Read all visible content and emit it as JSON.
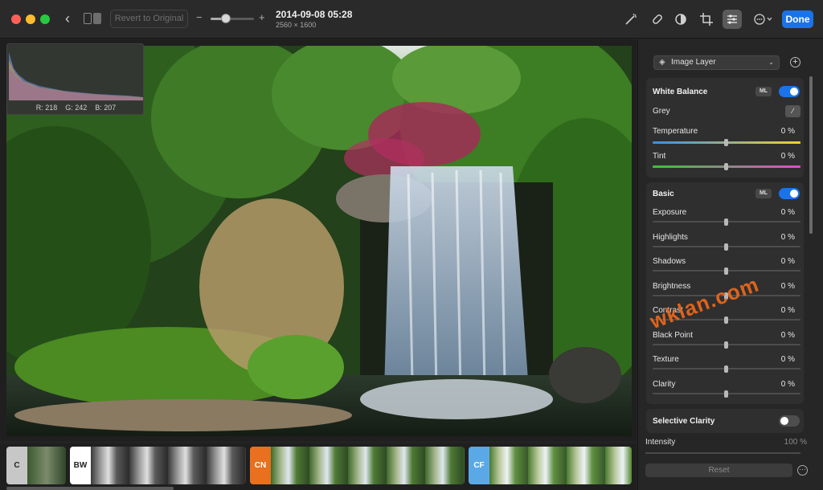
{
  "toolbar": {
    "revert_label": "Revert to Original",
    "zoom_minus": "−",
    "zoom_plus": "+",
    "zoom_level": 0.35,
    "title": "2014-09-08 05:28",
    "dimensions": "2560 × 1600",
    "done_label": "Done",
    "icons": [
      "auto-enhance-icon",
      "retouch-icon",
      "color-icon",
      "crop-icon",
      "adjust-icon",
      "more-icon"
    ]
  },
  "histogram": {
    "r": "R: 218",
    "g": "G: 242",
    "b": "B: 207"
  },
  "filmstrip": [
    {
      "label": "C",
      "color": "#c7c7c7"
    },
    {
      "label": "BW",
      "color": "#ffffff"
    },
    {
      "label": "CN",
      "color": "#e8701e"
    },
    {
      "label": "CF",
      "color": "#5aa9e6"
    }
  ],
  "panel": {
    "layer": "Image Layer",
    "white_balance": {
      "title": "White Balance",
      "ml": "ML",
      "grey": "Grey",
      "rows": [
        {
          "label": "Temperature",
          "value": "0 %"
        },
        {
          "label": "Tint",
          "value": "0 %"
        }
      ]
    },
    "basic": {
      "title": "Basic",
      "ml": "ML",
      "rows": [
        {
          "label": "Exposure",
          "value": "0 %"
        },
        {
          "label": "Highlights",
          "value": "0 %"
        },
        {
          "label": "Shadows",
          "value": "0 %"
        },
        {
          "label": "Brightness",
          "value": "0 %"
        },
        {
          "label": "Contrast",
          "value": "0 %"
        },
        {
          "label": "Black Point",
          "value": "0 %"
        },
        {
          "label": "Texture",
          "value": "0 %"
        },
        {
          "label": "Clarity",
          "value": "0 %"
        }
      ]
    },
    "selective_clarity": {
      "title": "Selective Clarity"
    },
    "intensity": {
      "label": "Intensity",
      "value": "100 %"
    },
    "reset_label": "Reset"
  },
  "watermark": "wklan.com"
}
